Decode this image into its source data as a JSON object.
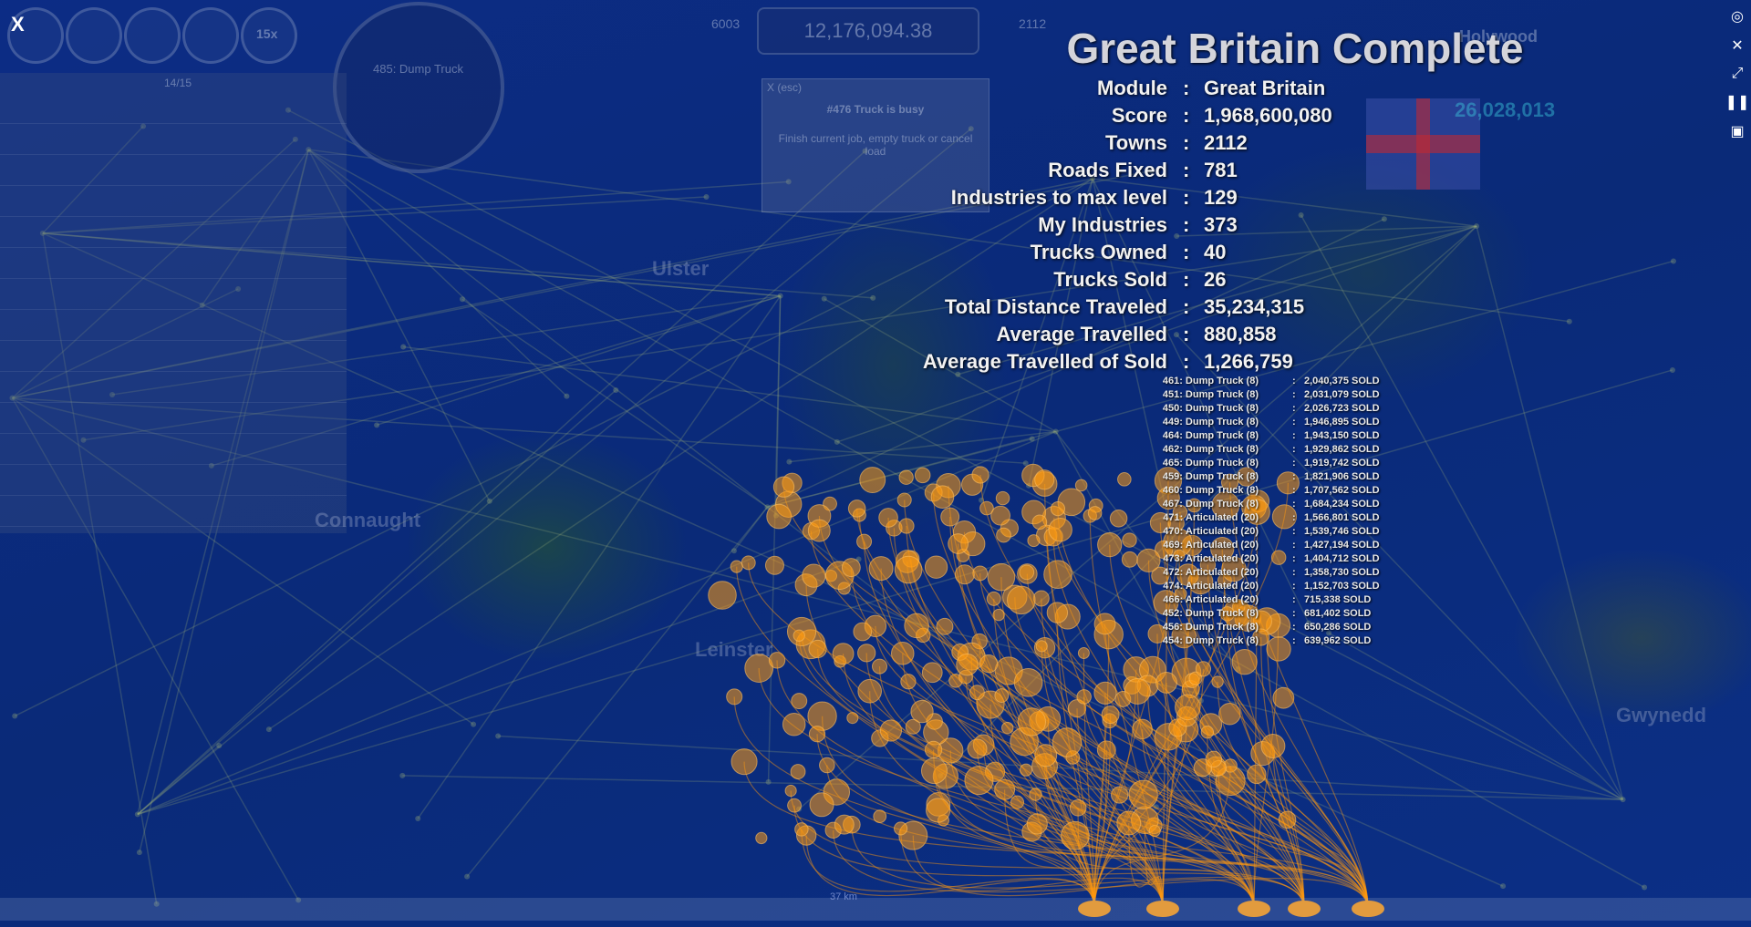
{
  "window": {
    "close_label": "X"
  },
  "summary": {
    "title": "Great Britain Complete",
    "separator": ":",
    "stats": [
      {
        "label": "Module",
        "value": "Great Britain"
      },
      {
        "label": "Score",
        "value": "1,968,600,080"
      },
      {
        "label": "Towns",
        "value": "2112"
      },
      {
        "label": "Roads Fixed",
        "value": "781"
      },
      {
        "label": "Industries to max level",
        "value": "129"
      },
      {
        "label": "My Industries",
        "value": "373"
      },
      {
        "label": "Trucks Owned",
        "value": "40"
      },
      {
        "label": "Trucks Sold",
        "value": "26"
      },
      {
        "label": "Total Distance Traveled",
        "value": "35,234,315"
      },
      {
        "label": "Average Travelled",
        "value": "880,858"
      },
      {
        "label": "Average Travelled of Sold",
        "value": "1,266,759"
      }
    ],
    "sold_trucks": [
      {
        "name": "461: Dump Truck (8)",
        "value": "2,040,375 SOLD"
      },
      {
        "name": "451: Dump Truck (8)",
        "value": "2,031,079 SOLD"
      },
      {
        "name": "450: Dump Truck (8)",
        "value": "2,026,723 SOLD"
      },
      {
        "name": "449: Dump Truck (8)",
        "value": "1,946,895 SOLD"
      },
      {
        "name": "464: Dump Truck (8)",
        "value": "1,943,150 SOLD"
      },
      {
        "name": "462: Dump Truck (8)",
        "value": "1,929,862 SOLD"
      },
      {
        "name": "465: Dump Truck (8)",
        "value": "1,919,742 SOLD"
      },
      {
        "name": "459: Dump Truck (8)",
        "value": "1,821,906 SOLD"
      },
      {
        "name": "460: Dump Truck (8)",
        "value": "1,707,562 SOLD"
      },
      {
        "name": "467: Dump Truck (8)",
        "value": "1,684,234 SOLD"
      },
      {
        "name": "471: Articulated (20)",
        "value": "1,566,801 SOLD"
      },
      {
        "name": "470: Articulated (20)",
        "value": "1,539,746 SOLD"
      },
      {
        "name": "469: Articulated (20)",
        "value": "1,427,194 SOLD"
      },
      {
        "name": "473: Articulated (20)",
        "value": "1,404,712 SOLD"
      },
      {
        "name": "472: Articulated (20)",
        "value": "1,358,730 SOLD"
      },
      {
        "name": "474: Articulated (20)",
        "value": "1,152,703 SOLD"
      },
      {
        "name": "466: Articulated (20)",
        "value": "715,338 SOLD"
      },
      {
        "name": "452: Dump Truck (8)",
        "value": "681,402 SOLD"
      },
      {
        "name": "456: Dump Truck (8)",
        "value": "650,286 SOLD"
      },
      {
        "name": "454: Dump Truck (8)",
        "value": "639,962 SOLD"
      }
    ]
  },
  "background_hud": {
    "speedo_truck": "485: Dump Truck",
    "top_money": "12,176,094.38",
    "top_left_count": "6003",
    "top_right_count": "2112",
    "truck_list_page": "14/15",
    "popup_title": "#476 Truck is busy",
    "popup_body": "Finish current job, empty truck or cancel load",
    "popup_close": "X (esc)",
    "speed_multiplier": "15x",
    "right_money": "26,028,013",
    "right_town": "Holywood",
    "scale_label": "37 km"
  },
  "map_labels": [
    "Ulster",
    "Connaught",
    "Leinster",
    "Gwynedd"
  ],
  "colors": {
    "accent_orange": "#ff9a10",
    "sea": "#0a2a7a"
  }
}
